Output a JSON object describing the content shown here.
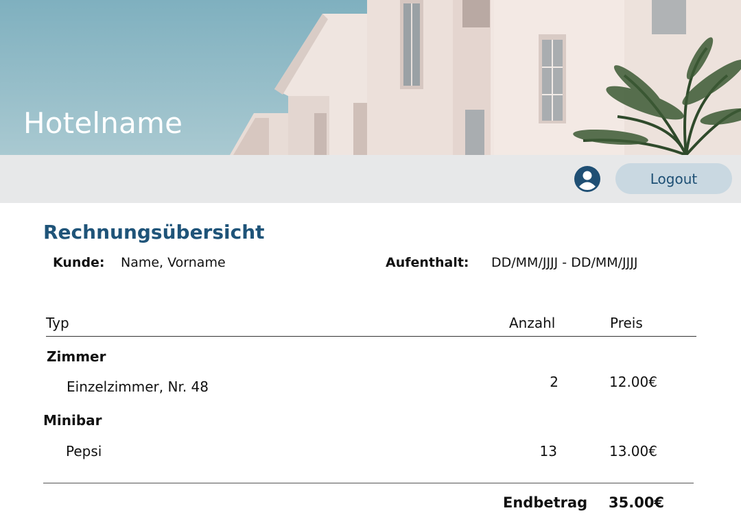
{
  "header": {
    "hotel_name": "Hotelname"
  },
  "navbar": {
    "logout_label": "Logout",
    "avatar_icon": "user-circle-icon"
  },
  "invoice": {
    "title": "Rechnungsübersicht",
    "customer_label": "Kunde:",
    "customer_value": "Name, Vorname",
    "stay_label": "Aufenthalt:",
    "stay_value": "DD/MM/JJJJ - DD/MM/JJJJ",
    "columns": {
      "type": "Typ",
      "quantity": "Anzahl",
      "price": "Preis"
    },
    "categories": [
      {
        "name": "Zimmer",
        "items": [
          {
            "label": "Einzelzimmer, Nr. 48",
            "quantity": "2",
            "price": "12.00€"
          }
        ]
      },
      {
        "name": "Minibar",
        "items": [
          {
            "label": "Pepsi",
            "quantity": "13",
            "price": "13.00€"
          }
        ]
      }
    ],
    "total_label": "Endbetrag",
    "total_value": "35.00€"
  },
  "colors": {
    "accent": "#1f5479",
    "logout_bg": "#c9d8e1",
    "navbar_bg": "#e7e8e9",
    "sky": "#8fbcc8"
  }
}
